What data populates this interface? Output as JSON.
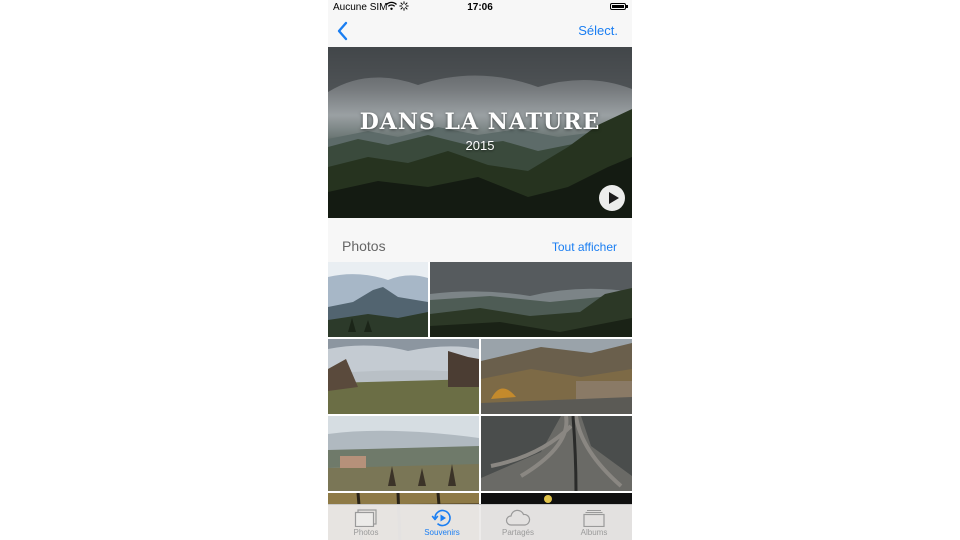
{
  "status_bar": {
    "carrier": "Aucune SIM",
    "time": "17:06"
  },
  "nav": {
    "back_icon": "chevron-left-icon",
    "select_label": "Sélect."
  },
  "hero": {
    "title": "DANS LA NATURE",
    "subtitle": "2015",
    "play_icon": "play-icon"
  },
  "section": {
    "title": "Photos",
    "show_all_label": "Tout afficher"
  },
  "tabs": [
    {
      "label": "Photos",
      "icon": "photos-icon",
      "active": false
    },
    {
      "label": "Souvenirs",
      "icon": "memories-icon",
      "active": true
    },
    {
      "label": "Partagés",
      "icon": "cloud-icon",
      "active": false
    },
    {
      "label": "Albums",
      "icon": "albums-icon",
      "active": false
    }
  ],
  "colors": {
    "accent": "#1a7ef2",
    "inactive_tab": "#9a9a9a"
  }
}
